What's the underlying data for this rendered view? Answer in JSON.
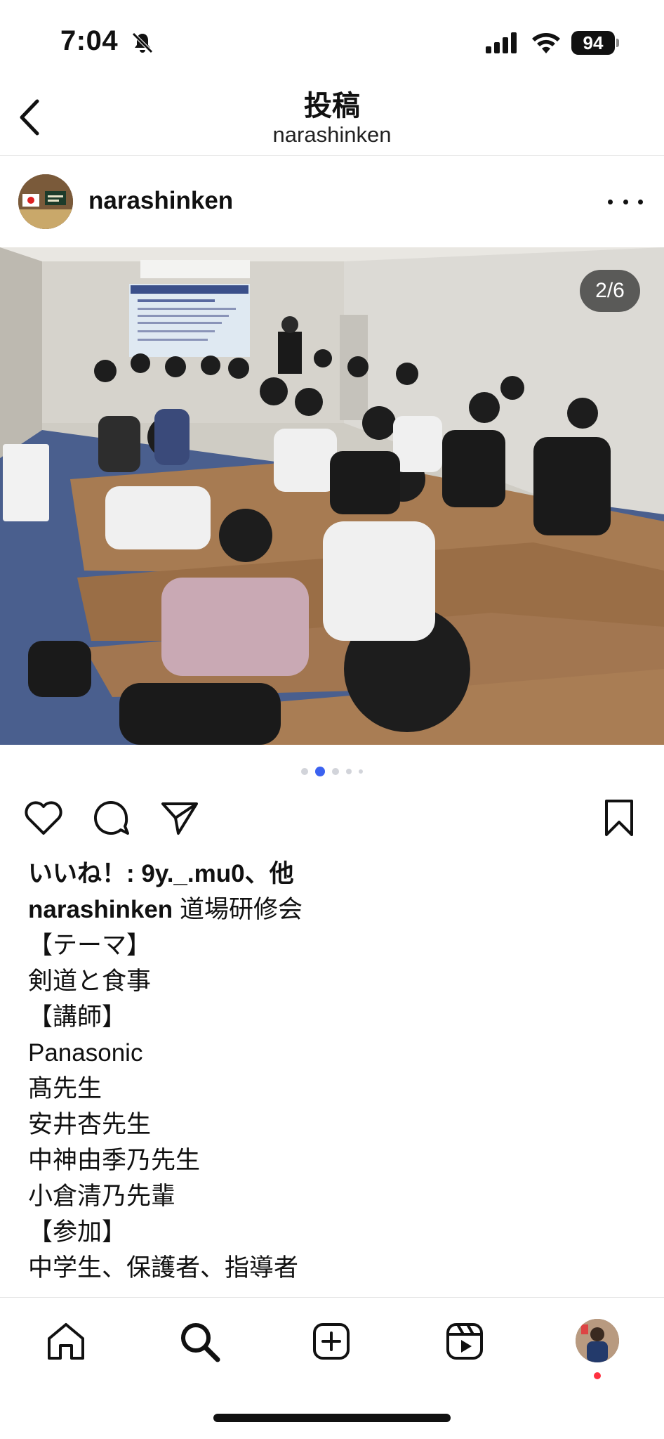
{
  "status_bar": {
    "time": "7:04",
    "battery": "94"
  },
  "header": {
    "title": "投稿",
    "subtitle": "narashinken"
  },
  "post": {
    "username": "narashinken",
    "photo_counter": "2/6",
    "carousel": {
      "count": 6,
      "active_index": 1
    },
    "likes_text": "いいね！: 9y._.mu0、他",
    "caption_author": "narashinken",
    "caption_first": "道場研修会",
    "caption_lines": [
      "【テーマ】",
      "剣道と食事",
      "【講師】",
      "Panasonic",
      "髙先生",
      "安井杏先生",
      "中神由季乃先生",
      "小倉清乃先輩",
      "【参加】",
      "中学生、保護者、指導者"
    ]
  },
  "colors": {
    "accent": "#3b62f0",
    "notification": "#ff3040",
    "text": "#111111"
  },
  "icons": {
    "back": "chevron-left-icon",
    "more": "more-horizontal-icon",
    "like": "heart-icon",
    "comment": "comment-icon",
    "share": "send-icon",
    "save": "bookmark-icon",
    "home": "home-icon",
    "search": "search-icon",
    "create": "add-square-icon",
    "reels": "reels-icon"
  }
}
